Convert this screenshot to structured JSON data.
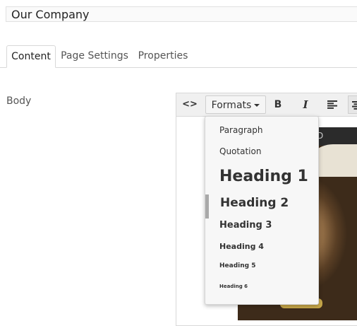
{
  "page": {
    "title_value": "Our Company"
  },
  "tabs": [
    {
      "label": "Content"
    },
    {
      "label": "Page Settings"
    },
    {
      "label": "Properties"
    }
  ],
  "body_label": "Body",
  "toolbar": {
    "source_icon": "<>",
    "formats_label": "Formats",
    "bold_label": "B",
    "italic_label": "I"
  },
  "formats_menu": {
    "items": [
      {
        "label": "Paragraph"
      },
      {
        "label": "Quotation"
      },
      {
        "label": "Heading 1"
      },
      {
        "label": "Heading 2"
      },
      {
        "label": "Heading 3"
      },
      {
        "label": "Heading 4"
      },
      {
        "label": "Heading 5"
      },
      {
        "label": "Heading 6"
      }
    ],
    "selected": "Heading 2"
  },
  "image_caption": "D"
}
